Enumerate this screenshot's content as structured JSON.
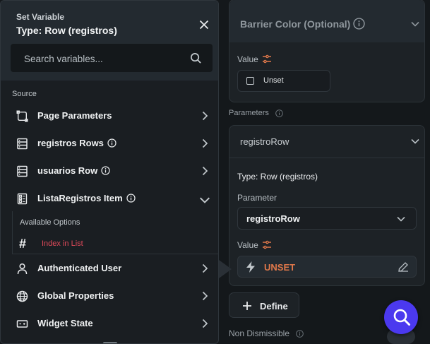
{
  "right_panel": {
    "barrier_color_label": "Barrier Color (Optional)",
    "value_label": "Value",
    "unset_checkbox_label": "Unset",
    "parameters_label": "Parameters",
    "param_name": "registroRow",
    "type_text": "Type: Row (registros)",
    "parameter_label": "Parameter",
    "parameter_select_value": "registroRow",
    "value_label_2": "Value",
    "unset_value": "UNSET",
    "define_button": "Define",
    "non_dismissible_label": "Non Dismissible"
  },
  "popover": {
    "subtitle": "Set Variable",
    "title": "Type: Row (registros)",
    "search_placeholder": "Search variables...",
    "section_label": "Source",
    "items": [
      {
        "label": "Page Parameters",
        "icon": "page-parameters-icon"
      },
      {
        "label": "registros Rows",
        "icon": "table-icon",
        "info": true
      },
      {
        "label": "usuarios Row",
        "icon": "table-icon",
        "info": true
      },
      {
        "label": "ListaRegistros Item",
        "icon": "list-icon",
        "info": true,
        "expanded": true
      },
      {
        "label": "Authenticated User",
        "icon": "user-icon"
      },
      {
        "label": "Global Properties",
        "icon": "globe-icon"
      },
      {
        "label": "Widget State",
        "icon": "widget-state-icon"
      }
    ],
    "available_options_label": "Available Options",
    "option_item": "Index in List"
  },
  "colors": {
    "accent": "#4b39ef",
    "unset_orange": "#e0784a",
    "index_red": "#e04a5a"
  }
}
